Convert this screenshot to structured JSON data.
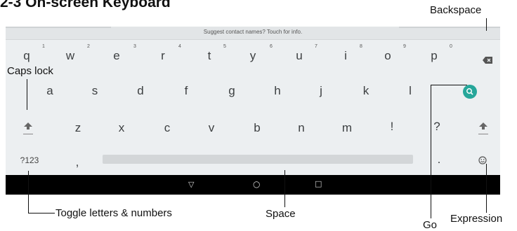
{
  "heading": "2-3 On-screen Keyboard",
  "keyboard": {
    "suggestion": "Suggest contact names? Touch for info.",
    "row1": [
      {
        "key": "q",
        "hint": "1"
      },
      {
        "key": "w",
        "hint": "2"
      },
      {
        "key": "e",
        "hint": "3"
      },
      {
        "key": "r",
        "hint": "4"
      },
      {
        "key": "t",
        "hint": "5"
      },
      {
        "key": "y",
        "hint": "6"
      },
      {
        "key": "u",
        "hint": "7"
      },
      {
        "key": "i",
        "hint": "8"
      },
      {
        "key": "o",
        "hint": "9"
      },
      {
        "key": "p",
        "hint": "0"
      }
    ],
    "row2": [
      "a",
      "s",
      "d",
      "f",
      "g",
      "h",
      "j",
      "k",
      "l"
    ],
    "row3": [
      "z",
      "x",
      "c",
      "v",
      "b",
      "n",
      "m",
      "!",
      "?"
    ],
    "row4": {
      "toggle": "?123",
      "comma": ",",
      "period": "."
    },
    "icons": {
      "backspace": "backspace-icon",
      "go": "search-icon",
      "shift_left": "shift-arrow-icon",
      "shift_right": "shift-arrow-icon",
      "emoji": "smiley-icon"
    },
    "accent_color": "#26a69a"
  },
  "navbar": {
    "back": "▽",
    "home": "○",
    "recent": "□"
  },
  "callouts": {
    "backspace": "Backspace",
    "caps_lock": "Caps lock",
    "toggle": "Toggle letters & numbers",
    "space": "Space",
    "go": "Go",
    "expression": "Expression"
  }
}
